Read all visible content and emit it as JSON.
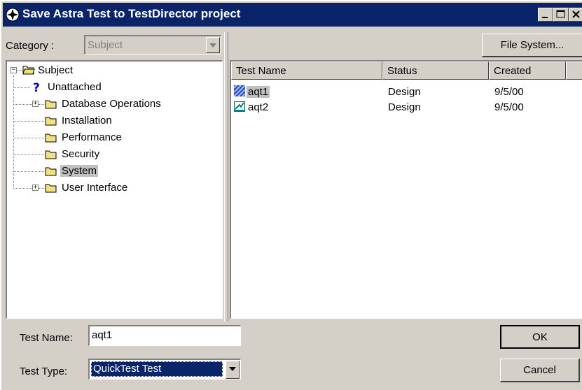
{
  "window": {
    "title": "Save Astra Test to TestDirector project"
  },
  "category": {
    "label": "Category :",
    "value": "Subject"
  },
  "toolbar": {
    "file_system_label": "File System..."
  },
  "tree": {
    "root": "Subject",
    "items": [
      {
        "label": "Unattached",
        "icon": "question-icon",
        "expandable": false
      },
      {
        "label": "Database Operations",
        "icon": "folder-icon",
        "expandable": true
      },
      {
        "label": "Installation",
        "icon": "folder-icon",
        "expandable": false
      },
      {
        "label": "Performance",
        "icon": "folder-icon",
        "expandable": false
      },
      {
        "label": "Security",
        "icon": "folder-icon",
        "expandable": false
      },
      {
        "label": "System",
        "icon": "folder-icon",
        "expandable": false,
        "selected": true
      },
      {
        "label": "User Interface",
        "icon": "folder-icon",
        "expandable": true
      }
    ]
  },
  "list": {
    "columns": [
      "Test Name",
      "Status",
      "Created"
    ],
    "rows": [
      {
        "name": "aqt1",
        "status": "Design",
        "created": "9/5/00",
        "icon": "quicktest-icon",
        "selected": true
      },
      {
        "name": "aqt2",
        "status": "Design",
        "created": "9/5/00",
        "icon": "astra-test-icon"
      }
    ]
  },
  "form": {
    "test_name_label": "Test Name:",
    "test_name_value": "aqt1",
    "test_type_label": "Test Type:",
    "test_type_value": "QuickTest Test"
  },
  "buttons": {
    "ok_label": "OK",
    "cancel_label": "Cancel"
  },
  "colors": {
    "title_bar": "#0a246a",
    "face": "#d4d0c8",
    "selection": "#0a246a"
  }
}
